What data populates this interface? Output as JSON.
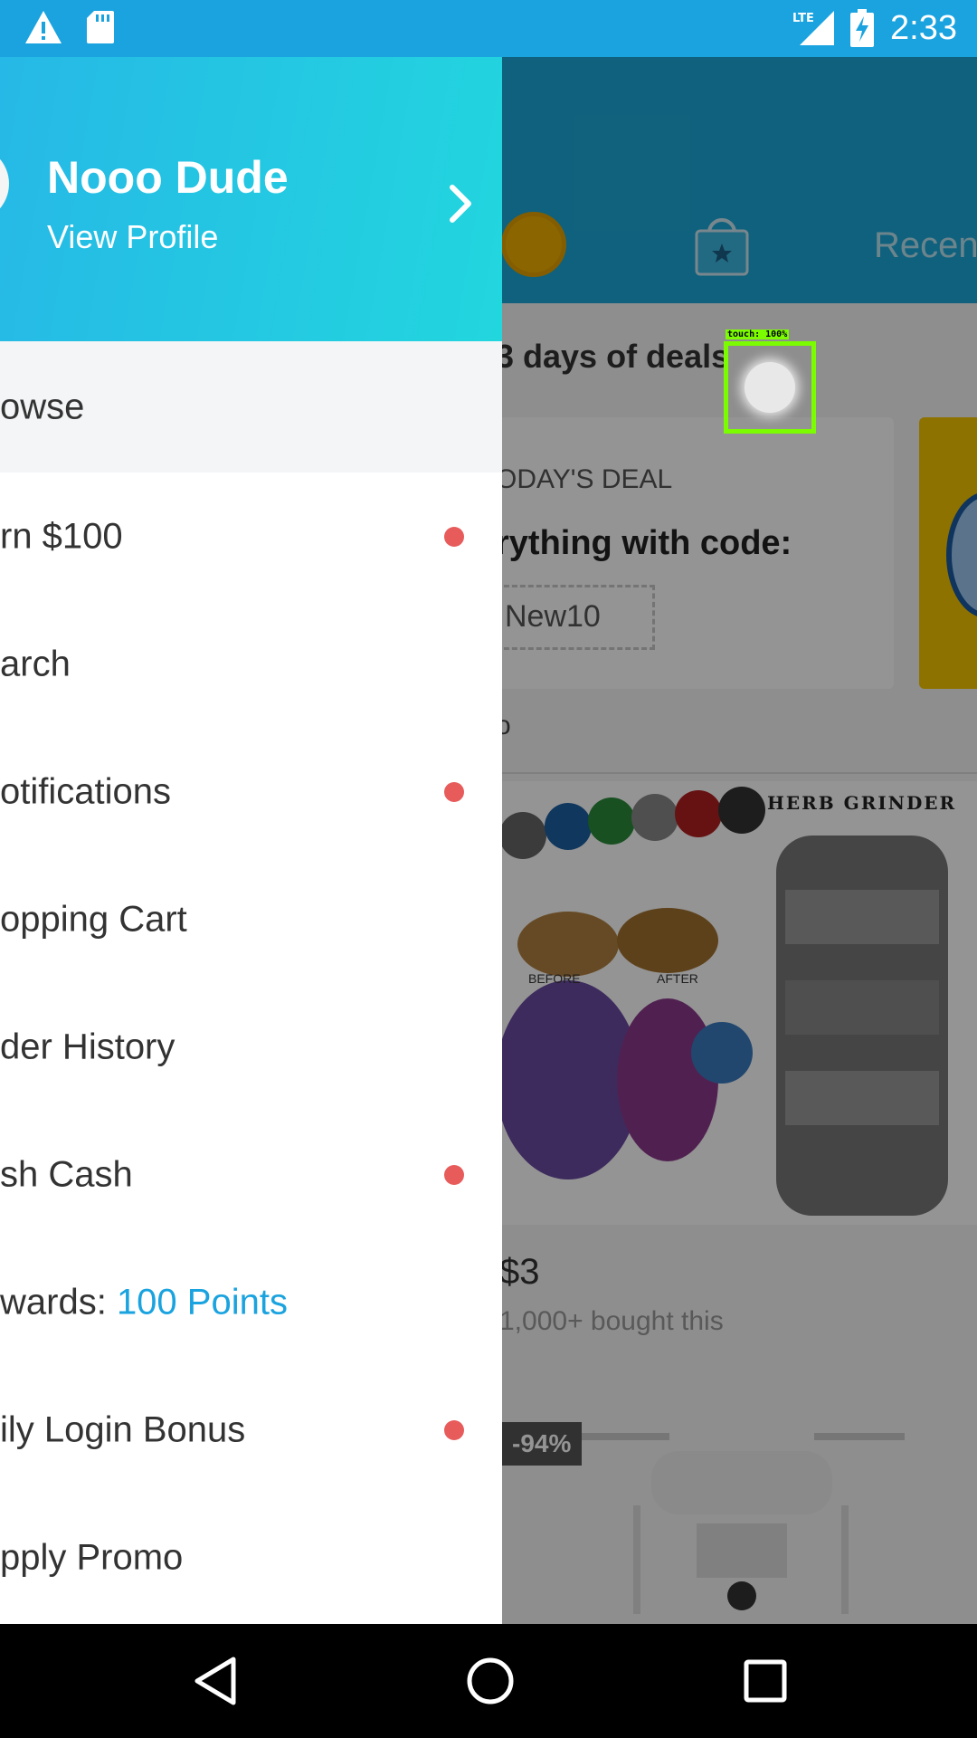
{
  "status_bar": {
    "time": "2:33",
    "network_label": "LTE",
    "icons": [
      "warning-icon",
      "sd-card-icon",
      "lte-signal-icon",
      "battery-charging-icon"
    ]
  },
  "background": {
    "header_tab": "Recen",
    "section_title": "3 days of deals",
    "deal": {
      "label": "ODAY'S DEAL",
      "text": "rything with code:",
      "code": "New10"
    },
    "row_text": "o",
    "product": {
      "image_title": "HERB GRINDER",
      "label_before": "BEFORE",
      "label_after": "AFTER",
      "price": "$3",
      "bought": "1,000+ bought this"
    },
    "discount_badge": "-94%"
  },
  "touch_indicator": {
    "label": "touch: 100%"
  },
  "drawer": {
    "user_name": "Nooo Dude",
    "view_profile": "View Profile",
    "items": [
      {
        "label": "owse",
        "badge": false
      },
      {
        "label": "rn $100",
        "badge": true
      },
      {
        "label": "arch",
        "badge": false
      },
      {
        "label": "otifications",
        "badge": true
      },
      {
        "label": "opping Cart",
        "badge": false
      },
      {
        "label": "der History",
        "badge": false
      },
      {
        "label": "sh Cash",
        "badge": true
      },
      {
        "label": "wards: ",
        "accent": "100 Points",
        "badge": false
      },
      {
        "label": "ily Login Bonus",
        "badge": true
      },
      {
        "label": "pply Promo",
        "badge": false
      }
    ]
  },
  "colors": {
    "status_bar": "#1aa3df",
    "accent": "#1aa3df",
    "badge_dot": "#e85b5b",
    "touch_box": "#7cfc00"
  }
}
